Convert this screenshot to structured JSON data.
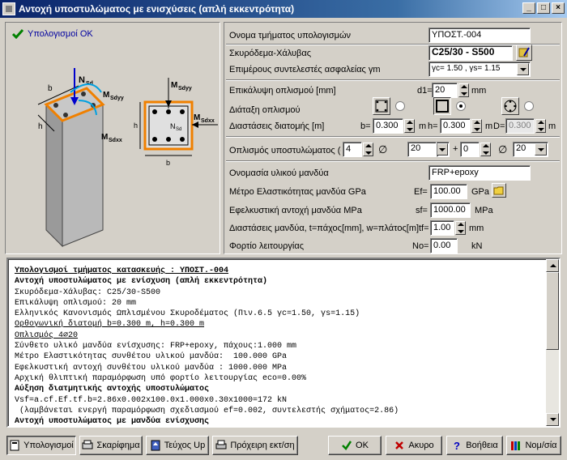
{
  "window": {
    "title": "Αντοχή υποστυλώματος με ενισχύσεις (απλή εκκεντρότητα)",
    "controls": [
      "_",
      "□",
      "×"
    ]
  },
  "status": {
    "text": "Υπολογισμοί ΟΚ",
    "icon": "checkmark-icon",
    "color": "#008000"
  },
  "figure": {
    "labels": {
      "nsd": "N",
      "nsd_sub": "Sd",
      "msdyy": "M",
      "msdyy_sub": "Sdyy",
      "msdxx": "M",
      "msdxx_sub": "Sdxx",
      "b": "b",
      "h": "h"
    },
    "section_labels": {
      "my": "M",
      "my_sub": "Sdyy",
      "mx": "M",
      "mx_sub": "Sdxx",
      "n": "N",
      "n_sub": "Sd",
      "h": "h",
      "b": "b"
    }
  },
  "form": {
    "calc_name_label": "Ονομα τμήματος υπολογισμών",
    "calc_name_value": "ΥΠΟΣΤ.-004",
    "materials_label": "Σκυρόδεμα-Χάλυβας",
    "materials_value": "C25/30 - S500",
    "safety_label": "Επιμέρους συντελεστές ασφαλείας γm",
    "safety_value": "γc= 1.50 , γs= 1.15",
    "cover_label": "Επικάλυψη οπλισμού [mm]",
    "cover_prefix": "d1=",
    "cover_value": "20",
    "cover_unit": "mm",
    "layout_label": "Διάταξη οπλισμού",
    "dims_label": "Διαστάσεις διατομής [m]",
    "b_prefix": "b=",
    "b_value": "0.300",
    "b_unit": "m",
    "h_prefix": "h=",
    "h_value": "0.300",
    "h_unit": "m",
    "d_prefix": "D=",
    "d_value": "0.300",
    "d_unit": "m",
    "rebar_label": "Οπλισμός υποστυλώματος (συνολικό",
    "rebar_n1": "4",
    "rebar_phi1": "20",
    "rebar_plus": "+",
    "rebar_n2": "0",
    "rebar_phi2": "20",
    "phi_symbol": "∅",
    "jacket_name_label": "Ονομασία υλικού μανδύα",
    "jacket_name_value": "FRP+epoxy",
    "ef_label": "Μέτρο Ελαστικότητας μανδύα GPa",
    "ef_prefix": "Ef=",
    "ef_value": "100.00",
    "ef_unit": "GPa",
    "sf_label": "Εφελκυστική αντοχή μανδύα MPa",
    "sf_prefix": "sf=",
    "sf_value": "1000.00",
    "sf_unit": "MPa",
    "tf_label": "Διαστάσεις μανδύα, t=πάχος[mm], w=πλάτος[m]",
    "tf_prefix": "tf=",
    "tf_value": "1.00",
    "tf_unit": "mm",
    "no_label": "Φορτίο λειτουργίας",
    "no_prefix": "No=",
    "no_value": "0.00",
    "no_unit": "kN"
  },
  "output_lines": [
    {
      "text": "Υπολογισμοί τμήματος κατασκευής : ΥΠΟΣΤ.-004",
      "style": "bu"
    },
    {
      "text": "Αντοχή υποστυλώματος με ενίσχυση (απλή εκκεντρότητα)",
      "style": "b"
    },
    {
      "text": "Σκυρόδεμα-Χάλυβας: C25/30-S500",
      "style": ""
    },
    {
      "text": "Επικάλυψη οπλισμού: 20 mm",
      "style": ""
    },
    {
      "text": "Ελληνικός Κανονισμός Ωπλισμένου Σκυροδέματος (Πιν.6.5 γc=1.50, γs=1.15)",
      "style": ""
    },
    {
      "text": "Ορθογωνική διατομή b=0.300 m, h=0.300 m",
      "style": "u"
    },
    {
      "text": "Οπλισμός 4∅20",
      "style": "u"
    },
    {
      "text": "Σύνθετο υλικό μανδύα ενίσχυσης: FRP+epoxy, πάχους:1.000 mm",
      "style": ""
    },
    {
      "text": "Μέτρο Ελαστικότητας συνθέτου υλικού μανδύα:  100.000 GPa",
      "style": ""
    },
    {
      "text": "Εφελκυστική αντοχή συνθέτου υλικού μανδύα : 1000.000 MPa",
      "style": ""
    },
    {
      "text": "Αρχική θλιπτική παραμόρφωση υπό φορτίο λειτουργίας eco=0.00%",
      "style": ""
    },
    {
      "text": "Αύξηση διατμητικής αντοχής υποστυλώματος",
      "style": "b"
    },
    {
      "text": "Vsf=a.cf.Ef.tf.b=2.86x0.002x100.0x1.000x0.30x1000=172 kN",
      "style": ""
    },
    {
      "text": " (λαμβάνεται ενεργή παραμόρφωση σχεδιασμού ef=0.002, συντελεστής σχήματος=2.86)",
      "style": ""
    },
    {
      "text": "Αντοχή υποστυλώματος με μανδύα ενίσχυσης",
      "style": "b"
    }
  ],
  "buttons": [
    {
      "label": "Υπολογισμοί",
      "icon": "calculator-icon",
      "pressed": true
    },
    {
      "label": "Σκαρίφημα",
      "icon": "sketch-icon",
      "pressed": false
    },
    {
      "label": "Τεύχος Up",
      "icon": "document-up-icon",
      "pressed": false
    },
    {
      "label": "Πρόχειρη εκτ/ση",
      "icon": "printer-icon",
      "pressed": false
    },
    {
      "label": "ΟΚ",
      "icon": "ok-icon",
      "pressed": false
    },
    {
      "label": "Ακυρο",
      "icon": "cancel-icon",
      "pressed": false
    },
    {
      "label": "Βοήθεια",
      "icon": "help-icon",
      "pressed": false
    },
    {
      "label": "Νομ/σία",
      "icon": "books-icon",
      "pressed": false
    }
  ]
}
